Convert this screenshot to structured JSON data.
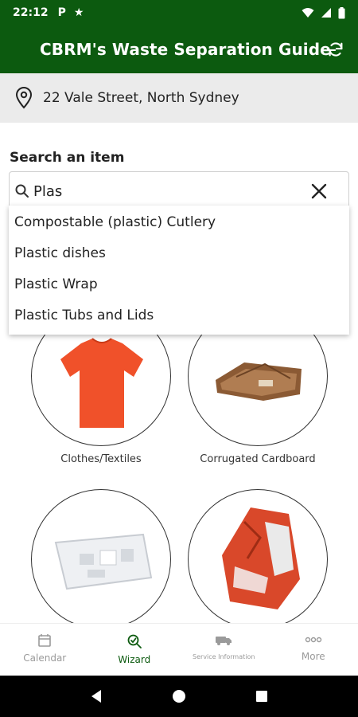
{
  "status_bar": {
    "time": "22:12",
    "left_icons": [
      "parking-icon",
      "star-icon"
    ],
    "right_icons": [
      "wifi-icon",
      "signal-icon",
      "battery-icon"
    ]
  },
  "app_bar": {
    "title": "CBRM's Waste Separation Guide",
    "action_icon": "refresh-icon",
    "color": "#0c5a0f"
  },
  "address": {
    "icon": "location-pin-icon",
    "text": "22 Vale Street, North Sydney"
  },
  "search": {
    "label": "Search an item",
    "value": "Plas",
    "icon": "search-icon",
    "clear_icon": "close-icon",
    "suggestions": [
      "Compostable (plastic) Cutlery",
      "Plastic dishes",
      "Plastic Wrap",
      "Plastic Tubs and Lids"
    ]
  },
  "items": [
    {
      "label": "Clothes/Textiles",
      "image": "orange t-shirt"
    },
    {
      "label": "Corrugated Cardboard",
      "image": "flattened cardboard boxes"
    },
    {
      "label": "",
      "image": "white polystyrene packaging"
    },
    {
      "label": "",
      "image": "crumpled red snack wrapper"
    }
  ],
  "bottom_nav": [
    {
      "label": "Calendar",
      "icon": "calendar-icon",
      "active": false
    },
    {
      "label": "Wizard",
      "icon": "wizard-search-icon",
      "active": true
    },
    {
      "label": "Service Information",
      "icon": "truck-icon",
      "active": false
    },
    {
      "label": "More",
      "icon": "more-dots-icon",
      "active": false
    }
  ],
  "system_nav": [
    "back-icon",
    "home-icon",
    "recents-icon"
  ]
}
